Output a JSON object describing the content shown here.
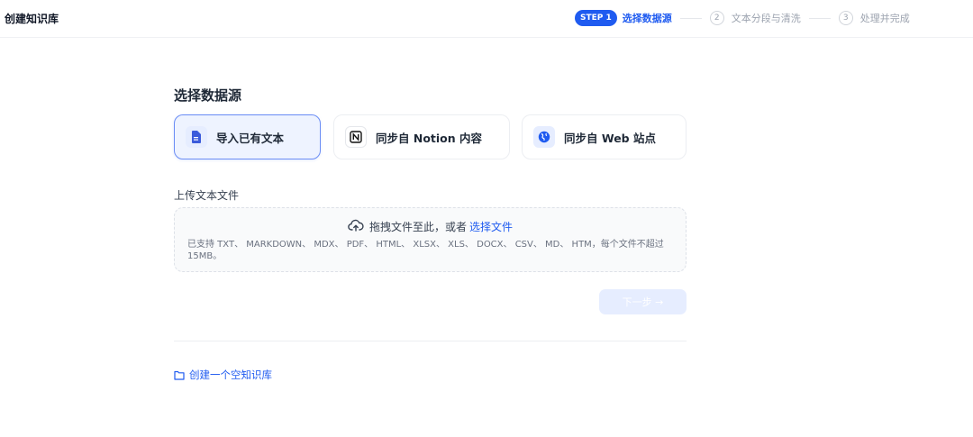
{
  "header": {
    "title": "创建知识库",
    "steps": [
      {
        "badge": "STEP 1",
        "label": "选择数据源",
        "active": true
      },
      {
        "num": "2",
        "label": "文本分段与清洗",
        "active": false
      },
      {
        "num": "3",
        "label": "处理并完成",
        "active": false
      }
    ]
  },
  "main": {
    "section_title": "选择数据源",
    "sources": [
      {
        "label": "导入已有文本",
        "icon": "file-text-icon",
        "selected": true
      },
      {
        "label": "同步自 Notion 内容",
        "icon": "notion-icon",
        "selected": false
      },
      {
        "label": "同步自 Web 站点",
        "icon": "globe-icon",
        "selected": false
      }
    ],
    "upload_label": "上传文本文件",
    "dropzone": {
      "prompt": "拖拽文件至此，或者",
      "link": "选择文件",
      "hint": "已支持 TXT、 MARKDOWN、 MDX、 PDF、 HTML、 XLSX、 XLS、 DOCX、 CSV、 MD、 HTM，每个文件不超过 15MB。"
    },
    "next_button": "下一步 →",
    "create_empty": "创建一个空知识库"
  },
  "colors": {
    "accent": "#1f5bf0",
    "selected_bg": "#eef3ff",
    "disabled_btn": "#e6edff"
  }
}
